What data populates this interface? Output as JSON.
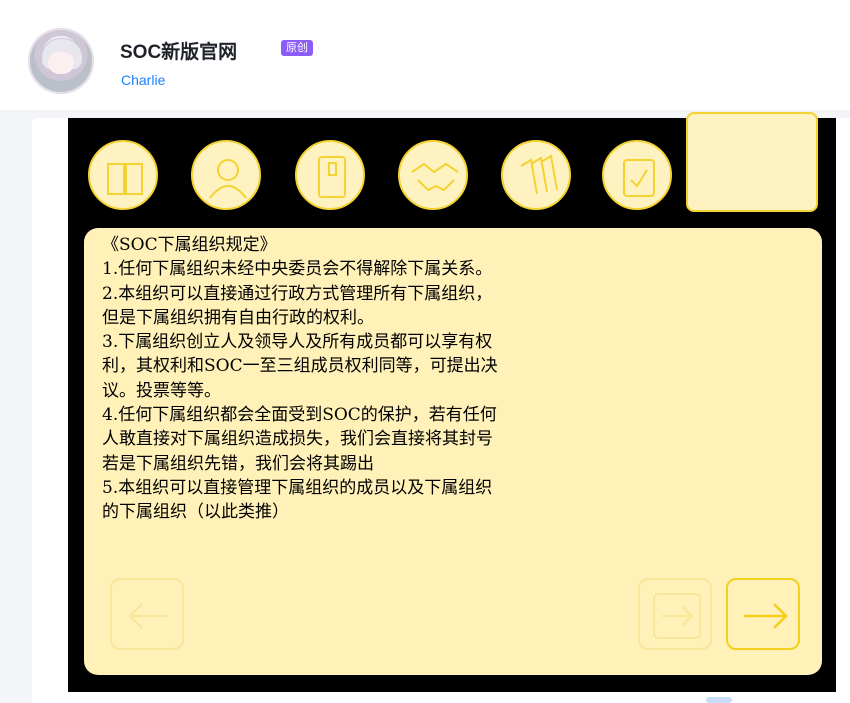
{
  "header": {
    "title": "SOC新版官网",
    "badge": "原创",
    "author": "Charlie"
  },
  "toolbar": {
    "icons": [
      "book-icon",
      "person-icon",
      "phone-icon",
      "handshake-icon",
      "documents-icon",
      "checkbox-icon"
    ]
  },
  "document": {
    "lines": [
      "《SOC下属组织规定》",
      "1.任何下属组织未经中央委员会不得解除下属关系。",
      "2.本组织可以直接通过行政方式管理所有下属组织，",
      "但是下属组织拥有自由行政的权利。",
      "3.下属组织创立人及领导人及所有成员都可以享有权",
      "利，其权利和SOC一至三组成员权利同等，可提出决",
      "议。投票等等。",
      "4.任何下属组织都会全面受到SOC的保护，若有任何",
      "人敢直接对下属组织造成损失，我们会直接将其封号",
      "若是下属组织先错，我们会将其踢出",
      "5.本组织可以直接管理下属组织的成员以及下属组织",
      "的下属组织（以此类推）"
    ]
  },
  "navigation": {
    "prev": "arrow-left-icon",
    "middle": "arrow-right-outline-icon",
    "next": "arrow-right-icon"
  },
  "colors": {
    "accent_yellow": "#f4d232",
    "panel_fill": "#fff1b8",
    "badge_purple": "#8b5cf6",
    "author_blue": "#1e80ff"
  }
}
